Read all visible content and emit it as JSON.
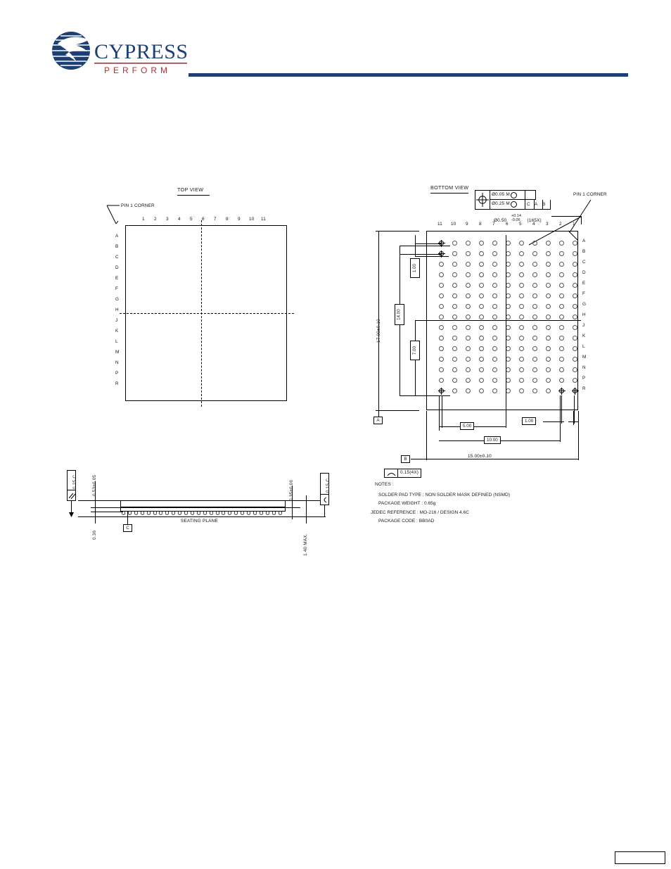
{
  "header": {
    "brand": "CYPRESS",
    "tagline": "PERFORM",
    "rule_color": "#1d3f73"
  },
  "top_view": {
    "title": "TOP VIEW",
    "pin1_label": "PIN 1 CORNER",
    "columns": [
      "1",
      "2",
      "3",
      "4",
      "5",
      "6",
      "7",
      "8",
      "9",
      "10",
      "11"
    ],
    "rows": [
      "A",
      "B",
      "C",
      "D",
      "E",
      "F",
      "G",
      "H",
      "J",
      "K",
      "L",
      "M",
      "N",
      "P",
      "R"
    ]
  },
  "bottom_view": {
    "title": "BOTTOM VIEW",
    "pin1_label": "PIN 1 CORNER",
    "columns": [
      "11",
      "10",
      "9",
      "8",
      "7",
      "6",
      "5",
      "4",
      "3",
      "2",
      "1"
    ],
    "rows": [
      "A",
      "B",
      "C",
      "D",
      "E",
      "F",
      "G",
      "H",
      "J",
      "K",
      "L",
      "M",
      "N",
      "P",
      "R"
    ],
    "feature_control": {
      "row1_tolerance": "Ø0.05 M",
      "row1_datum": "C",
      "row2_tolerance": "Ø0.25 M",
      "row2_datums": [
        "C",
        "A",
        "B"
      ]
    },
    "ball_callout": {
      "diameter": "Ø0.50",
      "tol_plus": "+0.14",
      "tol_minus": "-0.06",
      "quantity": "(165X)"
    },
    "dimensions": {
      "overall_height": "17.00±0.10",
      "ball_span_height": "14.00",
      "edge_to_first_ball_v": "1.00",
      "mid_dim_v": "7.00",
      "overall_width": "15.00±0.10",
      "half_span_width": "5.00",
      "ball_span_width": "10.00",
      "edge_to_first_ball_h": "1.00"
    },
    "datums": {
      "a": "A",
      "b": "B"
    },
    "flatness_callout": "0.15(4X)"
  },
  "side_view": {
    "seating_plane_label": "SEATING PLANE",
    "datum_c": "C",
    "left_fcf": "0.25 C",
    "right_fcf": "0.15 C",
    "dim_body_thickness": "0.53±0.05",
    "dim_standoff": "0.36",
    "dim_ball_height": "0.35±0.06",
    "dim_total_height": "1.40 MAX."
  },
  "notes": {
    "heading": "NOTES :",
    "items": [
      "SOLDER PAD TYPE : NON SOLDER MASK DEFINED (NSMD)",
      "PACKAGE WEIGHT : 0.65g",
      "JEDEC REFERENCE : MO-216 / DESIGN 4.6C",
      "PACKAGE CODE : BB0AD"
    ]
  }
}
